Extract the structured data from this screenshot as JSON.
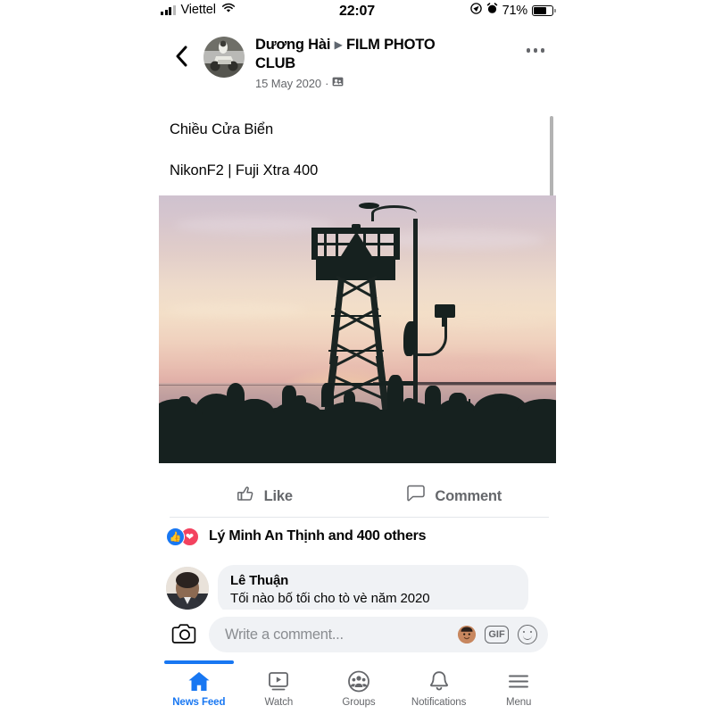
{
  "status_bar": {
    "carrier": "Viettel",
    "time": "22:07",
    "battery_percent": "71%",
    "icons": [
      "signal-bars-icon",
      "wifi-icon",
      "location-arrow-icon",
      "alarm-clock-icon",
      "battery-icon"
    ]
  },
  "post": {
    "author": "Dương Hài",
    "group": "FILM PHOTO CLUB",
    "arrow": "▶",
    "date": "15 May 2020",
    "privacy_icon": "group-audience-icon",
    "separator": "·",
    "text_line1": "Chiều Cửa Biển",
    "text_line2": "NikonF2 | Fuji Xtra 400",
    "photo_alt": "sunset-silhouette-photo",
    "back_icon": "back-chevron-icon",
    "more_icon": "more-options-icon"
  },
  "actions": {
    "like_label": "Like",
    "like_icon": "thumbs-up-icon",
    "comment_label": "Comment",
    "comment_icon": "speech-bubble-icon"
  },
  "reactions": {
    "summary": "Lý Minh An Thịnh and 400 others",
    "count": 400,
    "types": [
      "like",
      "love"
    ],
    "like_glyph": "👍",
    "love_glyph": "❤",
    "like_color": "#1877f2",
    "love_color": "#f3425f"
  },
  "comments": [
    {
      "author": "Lê Thuận",
      "text": "Tối nào bố tối cho tò vè năm 2020",
      "avatar": "commenter-avatar"
    }
  ],
  "composer": {
    "camera_icon": "camera-icon",
    "placeholder": "Write a comment...",
    "sticker_icon": "avatar-sticker-icon",
    "gif_label": "GIF",
    "emoji_icon": "smiley-icon"
  },
  "bottom_nav": {
    "active_index": 0,
    "items": [
      {
        "label": "News Feed",
        "icon": "home-icon"
      },
      {
        "label": "Watch",
        "icon": "video-play-icon"
      },
      {
        "label": "Groups",
        "icon": "groups-icon"
      },
      {
        "label": "Notifications",
        "icon": "bell-icon"
      },
      {
        "label": "Menu",
        "icon": "hamburger-menu-icon"
      }
    ]
  },
  "theme": {
    "accent": "#1877f2",
    "text_primary": "#050505",
    "text_secondary": "#65676b",
    "bubble_bg": "#f0f2f5"
  }
}
